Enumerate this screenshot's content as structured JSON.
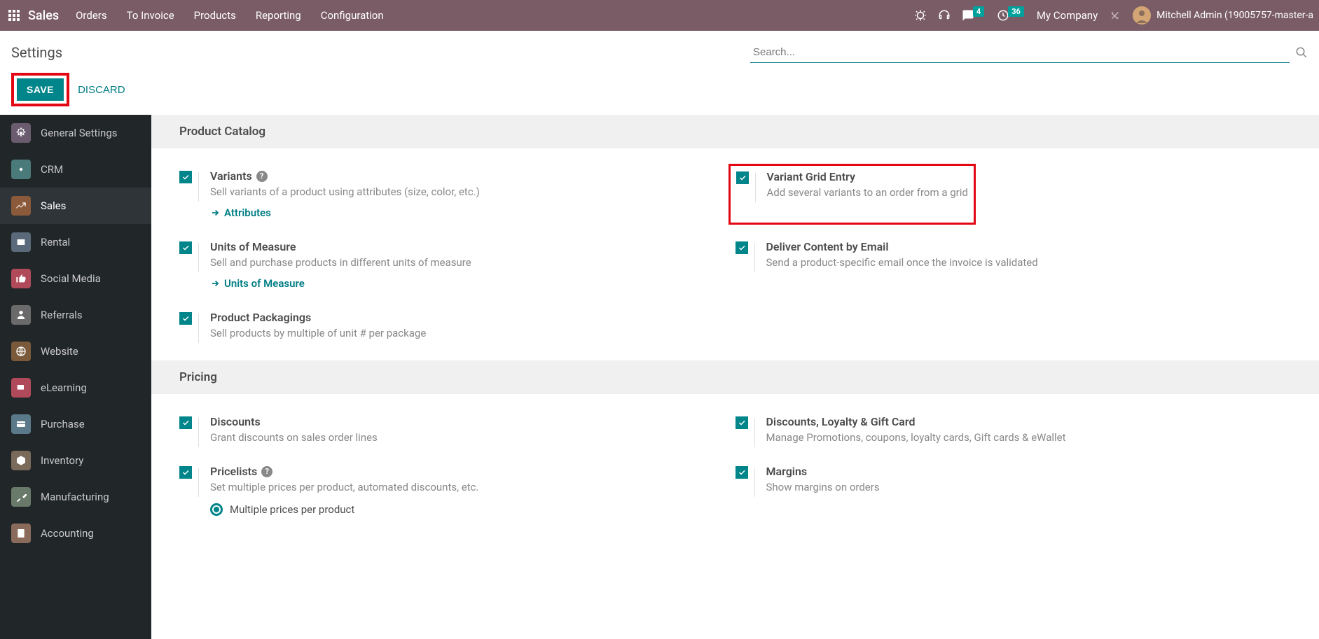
{
  "navbar": {
    "brand": "Sales",
    "links": [
      "Orders",
      "To Invoice",
      "Products",
      "Reporting",
      "Configuration"
    ],
    "msg_badge": "4",
    "activity_badge": "36",
    "company": "My Company",
    "user_name": "Mitchell Admin (19005757-master-a"
  },
  "controlbar": {
    "title": "Settings",
    "search_placeholder": "Search..."
  },
  "actions": {
    "save": "SAVE",
    "discard": "DISCARD"
  },
  "sidebar": {
    "items": [
      {
        "label": "General Settings"
      },
      {
        "label": "CRM"
      },
      {
        "label": "Sales"
      },
      {
        "label": "Rental"
      },
      {
        "label": "Social Media"
      },
      {
        "label": "Referrals"
      },
      {
        "label": "Website"
      },
      {
        "label": "eLearning"
      },
      {
        "label": "Purchase"
      },
      {
        "label": "Inventory"
      },
      {
        "label": "Manufacturing"
      },
      {
        "label": "Accounting"
      }
    ]
  },
  "sections": {
    "product_catalog": {
      "title": "Product Catalog",
      "variants": {
        "title": "Variants",
        "desc": "Sell variants of a product using attributes (size, color, etc.)",
        "link": "Attributes"
      },
      "variant_grid": {
        "title": "Variant Grid Entry",
        "desc": "Add several variants to an order from a grid"
      },
      "uom": {
        "title": "Units of Measure",
        "desc": "Sell and purchase products in different units of measure",
        "link": "Units of Measure"
      },
      "deliver_email": {
        "title": "Deliver Content by Email",
        "desc": "Send a product-specific email once the invoice is validated"
      },
      "packagings": {
        "title": "Product Packagings",
        "desc": "Sell products by multiple of unit # per package"
      }
    },
    "pricing": {
      "title": "Pricing",
      "discounts": {
        "title": "Discounts",
        "desc": "Grant discounts on sales order lines"
      },
      "loyalty": {
        "title": "Discounts, Loyalty & Gift Card",
        "desc": "Manage Promotions, coupons, loyalty cards, Gift cards & eWallet"
      },
      "pricelists": {
        "title": "Pricelists",
        "desc": "Set multiple prices per product, automated discounts, etc.",
        "radio1": "Multiple prices per product"
      },
      "margins": {
        "title": "Margins",
        "desc": "Show margins on orders"
      }
    }
  }
}
